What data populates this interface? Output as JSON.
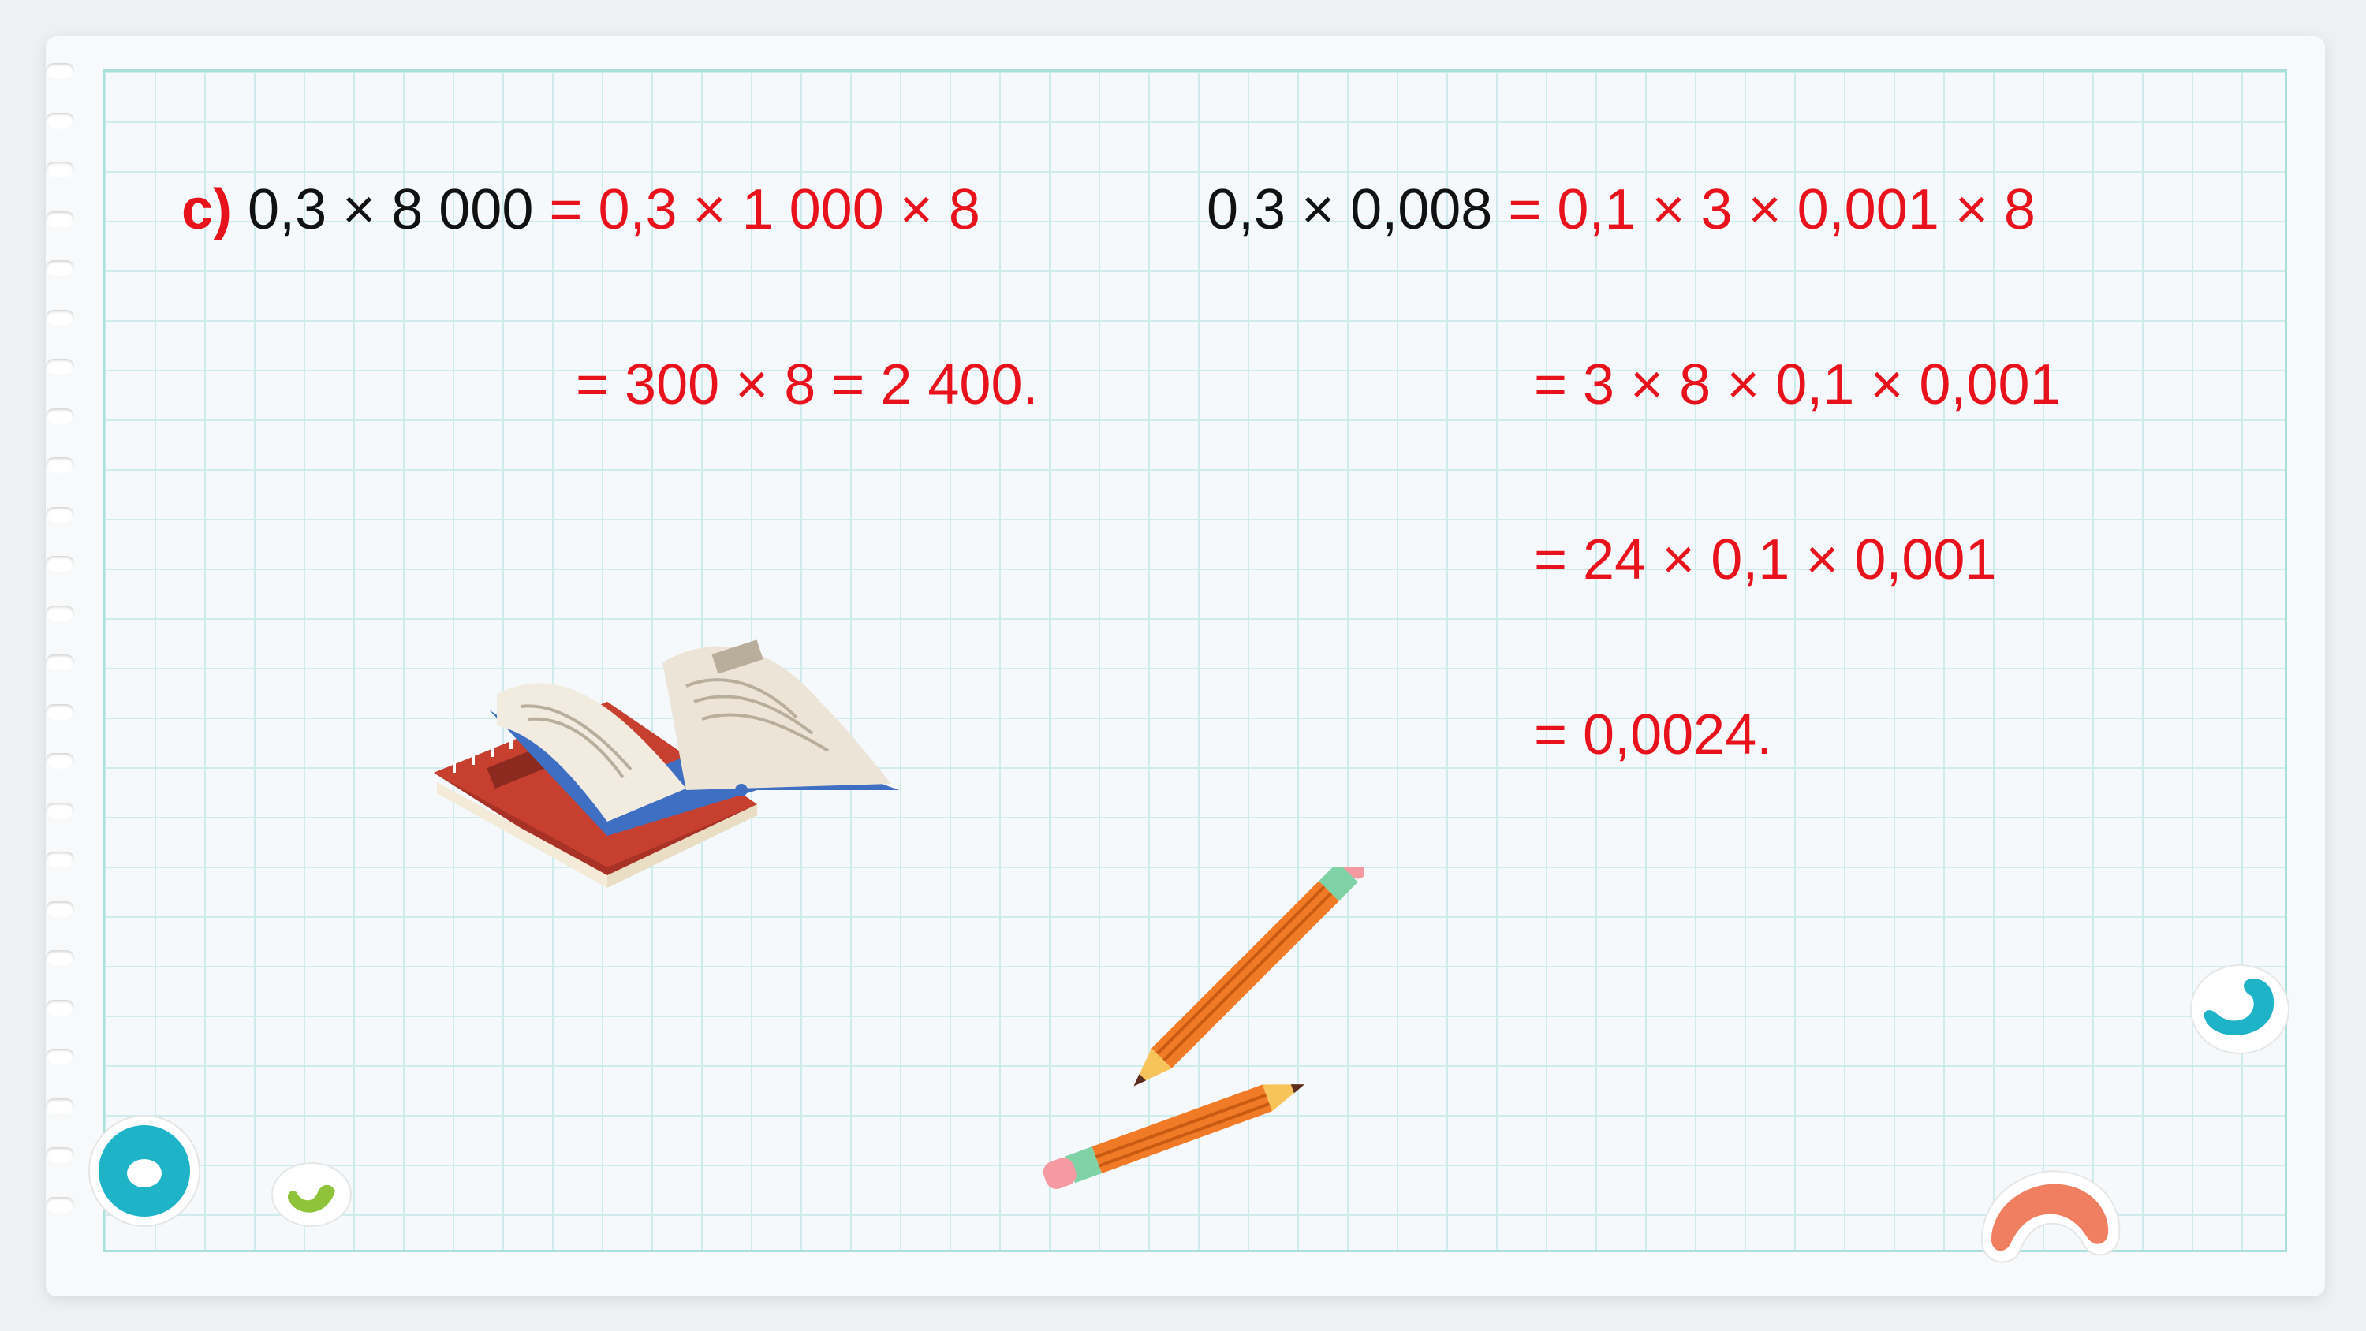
{
  "colors": {
    "accent_red": "#e8121c",
    "text_black": "#111111",
    "grid_line": "#cdeceb",
    "grid_border": "#a9e0dc"
  },
  "left": {
    "label": "c)",
    "lhs": "0,3 × 8 000",
    "rhs1": "= 0,3 × 1 000 × 8",
    "line2": "= 300 × 8 = 2 400."
  },
  "right": {
    "lhs": "0,3 × 0,008",
    "rhs1": "= 0,1 × 3 × 0,001 × 8",
    "line2": "= 3 × 8 × 0,1 × 0,001",
    "line3": "= 24 × 0,1 × 0,001",
    "line4": "= 0,0024."
  },
  "icons": [
    "notebook-ring-holes",
    "open-book-icon",
    "pencil-icon",
    "ring-sticker-icon",
    "bean-sticker-icon"
  ]
}
